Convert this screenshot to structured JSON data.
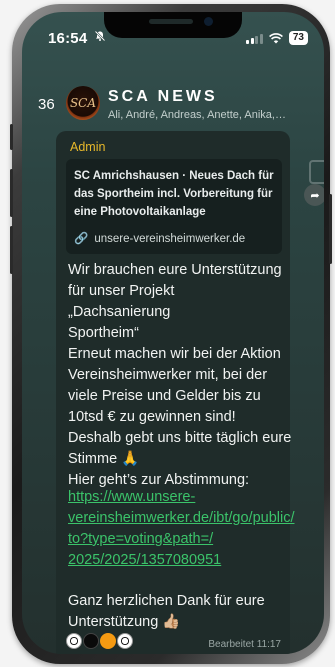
{
  "status_bar": {
    "time": "16:54",
    "mute_icon": "bell-slash-icon",
    "battery": "73"
  },
  "chat_header": {
    "unread_count": "36",
    "avatar_text": "SCA",
    "group_name": "SCA NEWS",
    "members": "Ali, André, Andreas, Anette, Anika,…"
  },
  "message": {
    "sender": "Admin",
    "link_preview": {
      "title": "SC Amrichshausen · Neues Dach für das Sportheim incl. Vorbereitung für eine Photovoltaikanlage",
      "domain": "unsere-vereinsheimwerker.de"
    },
    "body": "Wir brauchen eure Unterstützung für unser Projekt\n„Dachsanierung\nSportheim“\nErneut machen wir bei der Aktion Vereinsheimwerker mit, bei der viele Preise und Gelder bis zu 10tsd € zu gewinnen sind!\nDeshalb gebt uns bitte täglich eure Stimme 🙏\nHier geht’s zur Abstimmung:",
    "link": "https://www.unsere-\nvereinsheimwerker.de/ibt/go/public/\nto?type=voting&path=/\n2025/2025/1357080951",
    "thanks": "Ganz herzlichen Dank für eure Unterstützung 👍🏼",
    "emoji_row": [
      "⚽",
      "⚫",
      "🟠",
      "⚽"
    ],
    "edited_label": "Bearbeitet 11:17"
  },
  "colors": {
    "sender": "#e8b92a",
    "link": "#3bc36a",
    "bubble": "#1f2c2a"
  }
}
